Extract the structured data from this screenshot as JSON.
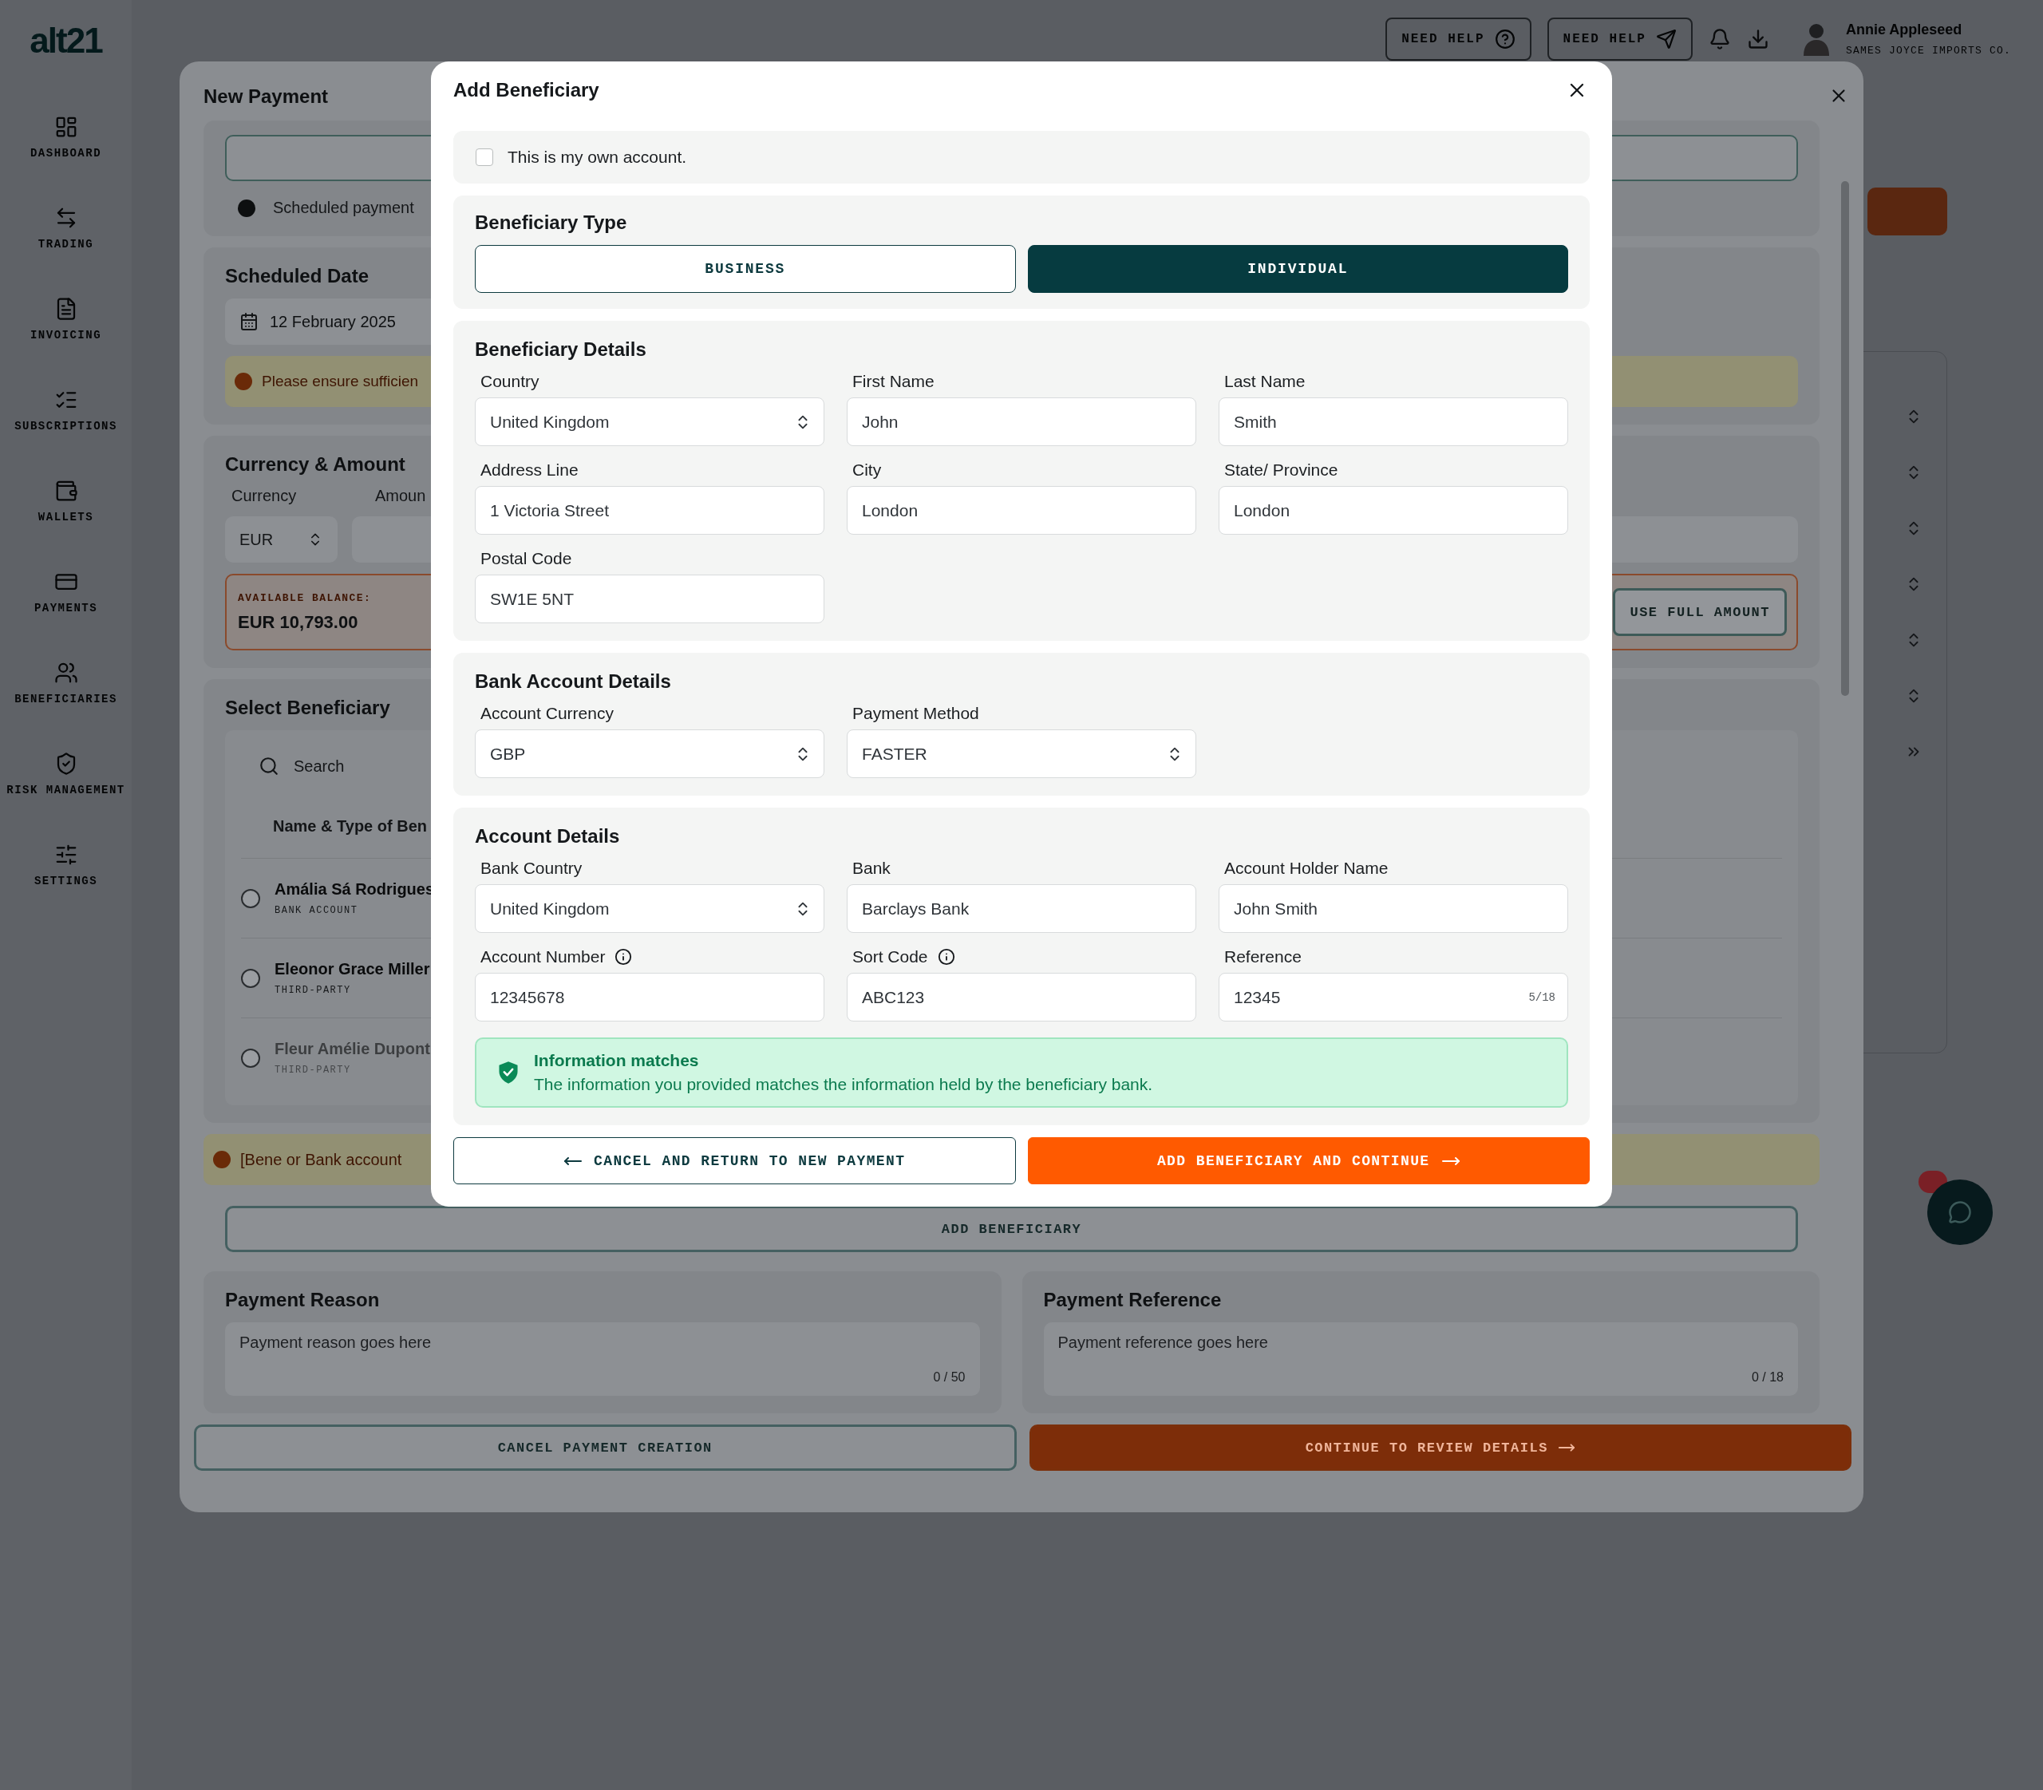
{
  "app": {
    "logo": "alt21"
  },
  "sidebar": {
    "items": [
      {
        "label": "DASHBOARD"
      },
      {
        "label": "TRADING"
      },
      {
        "label": "INVOICING"
      },
      {
        "label": "SUBSCRIPTIONS"
      },
      {
        "label": "WALLETS"
      },
      {
        "label": "PAYMENTS"
      },
      {
        "label": "BENEFICIARIES"
      },
      {
        "label": "RISK MANAGEMENT"
      },
      {
        "label": "SETTINGS"
      }
    ]
  },
  "top_bar": {
    "help_buttons": [
      {
        "label": "NEED HELP",
        "kind": "question"
      },
      {
        "label": "NEED HELP",
        "kind": "send"
      }
    ],
    "user": {
      "name": "Annie Appleseed",
      "company": "SAMES JOYCE IMPORTS CO."
    }
  },
  "new_payment": {
    "title": "New Payment",
    "scheduled_note": "Scheduled payment",
    "scheduled_date": {
      "title": "Scheduled Date",
      "value": "12 February 2025",
      "warning": "Please ensure sufficien"
    },
    "currency_amount": {
      "title": "Currency & Amount",
      "currency_label": "Currency",
      "amount_label": "Amoun",
      "currency": "EUR",
      "balance_label": "AVAILABLE BALANCE:",
      "balance": "EUR 10,793.00",
      "full_amount_button": "USE FULL AMOUNT"
    },
    "select_beneficiary": {
      "title": "Select Beneficiary",
      "search_placeholder": "Search",
      "column": "Name & Type of Ben",
      "rows": [
        {
          "name": "Amália Sá Rodrigues",
          "type": "BANK ACCOUNT",
          "selected": false,
          "disabled": false
        },
        {
          "name": "Eleonor Grace Miller",
          "type": "THIRD-PARTY",
          "selected": false,
          "disabled": false
        },
        {
          "name": "Fleur Amélie Dupont",
          "type": "THIRD-PARTY",
          "selected": false,
          "disabled": true
        }
      ],
      "warning": "[Bene or Bank account",
      "add_button": "ADD BENEFICIARY"
    },
    "payment_reason": {
      "title": "Payment Reason",
      "placeholder": "Payment reason goes here",
      "counter": "0 / 50"
    },
    "payment_reference": {
      "title": "Payment Reference",
      "placeholder": "Payment reference goes here",
      "counter": "0 / 18"
    },
    "buttons": [
      {
        "label": "CANCEL PAYMENT CREATION",
        "kind": "secondary"
      },
      {
        "label": "CONTINUE TO REVIEW DETAILS",
        "kind": "primary"
      }
    ]
  },
  "add_beneficiary": {
    "title": "Add Beneficiary",
    "own_account": {
      "label": "This is my own account.",
      "checked": false
    },
    "beneficiary_type": {
      "title": "Beneficiary Type",
      "options": [
        {
          "label": "BUSINESS",
          "selected": false
        },
        {
          "label": "INDIVIDUAL",
          "selected": true
        }
      ]
    },
    "sections": [
      {
        "title": "Beneficiary Details",
        "fields": [
          {
            "label": "Country",
            "value": "United Kingdom",
            "kind": "select"
          },
          {
            "label": "First Name",
            "value": "John",
            "kind": "text"
          },
          {
            "label": "Last Name",
            "value": "Smith",
            "kind": "text"
          },
          {
            "label": "Address Line",
            "value": "1 Victoria Street",
            "kind": "text"
          },
          {
            "label": "City",
            "value": "London",
            "kind": "text"
          },
          {
            "label": "State/ Province",
            "value": "London",
            "kind": "text"
          },
          {
            "label": "Postal Code",
            "value": "SW1E 5NT",
            "kind": "text"
          }
        ]
      },
      {
        "title": "Bank Account Details",
        "fields": [
          {
            "label": "Account Currency",
            "value": "GBP",
            "kind": "select"
          },
          {
            "label": "Payment Method",
            "value": "FASTER",
            "kind": "select"
          }
        ]
      },
      {
        "title": "Account Details",
        "fields": [
          {
            "label": "Bank Country",
            "value": "United Kingdom",
            "kind": "select"
          },
          {
            "label": "Bank",
            "value": "Barclays Bank",
            "kind": "text"
          },
          {
            "label": "Account Holder Name",
            "value": "John Smith",
            "kind": "text"
          },
          {
            "label": "Account Number",
            "value": "12345678",
            "kind": "text",
            "info": true
          },
          {
            "label": "Sort Code",
            "value": "ABC123",
            "kind": "text",
            "info": true
          },
          {
            "label": "Reference",
            "value": "12345",
            "kind": "text",
            "counter": "5/18"
          }
        ],
        "verification": {
          "title": "Information matches",
          "message": "The information you provided matches the information held by the beneficiary bank."
        }
      }
    ],
    "buttons": [
      {
        "label": "CANCEL AND RETURN TO NEW PAYMENT",
        "kind": "secondary"
      },
      {
        "label": "ADD BENEFICIARY AND CONTINUE",
        "kind": "primary"
      }
    ]
  }
}
